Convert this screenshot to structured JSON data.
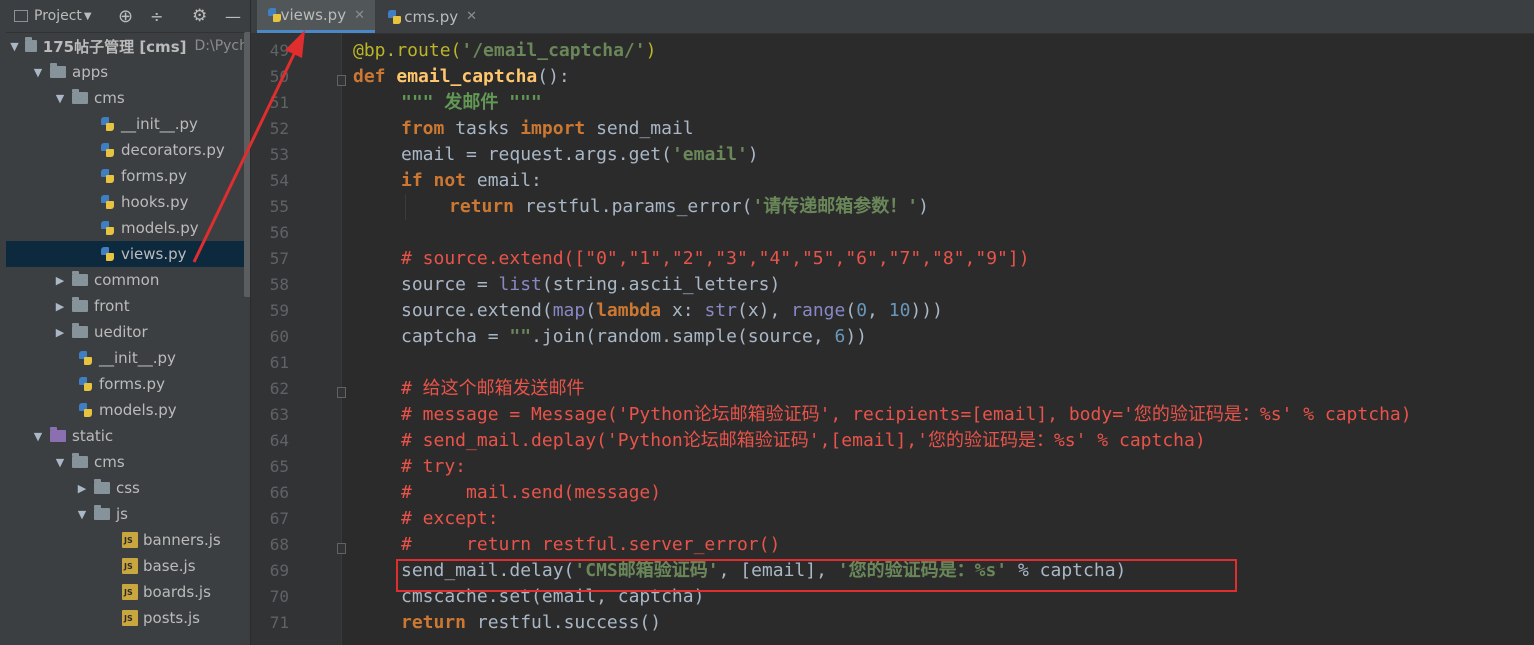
{
  "project_panel": {
    "title": "Project",
    "root_label": "175帖子管理 [cms]",
    "root_path": "D:\\Pych"
  },
  "tree": [
    {
      "label": "175帖子管理 [cms]",
      "kind": "root"
    },
    {
      "label": "apps",
      "kind": "folder"
    },
    {
      "label": "cms",
      "kind": "folder"
    },
    {
      "label": "__init__.py",
      "kind": "py"
    },
    {
      "label": "decorators.py",
      "kind": "py"
    },
    {
      "label": "forms.py",
      "kind": "py"
    },
    {
      "label": "hooks.py",
      "kind": "py"
    },
    {
      "label": "models.py",
      "kind": "py"
    },
    {
      "label": "views.py",
      "kind": "py"
    },
    {
      "label": "common",
      "kind": "folder"
    },
    {
      "label": "front",
      "kind": "folder"
    },
    {
      "label": "ueditor",
      "kind": "folder"
    },
    {
      "label": "__init__.py",
      "kind": "py"
    },
    {
      "label": "forms.py",
      "kind": "py"
    },
    {
      "label": "models.py",
      "kind": "py"
    },
    {
      "label": "static",
      "kind": "folder"
    },
    {
      "label": "cms",
      "kind": "folder"
    },
    {
      "label": "css",
      "kind": "folder"
    },
    {
      "label": "js",
      "kind": "folder"
    },
    {
      "label": "banners.js",
      "kind": "js"
    },
    {
      "label": "base.js",
      "kind": "js"
    },
    {
      "label": "boards.js",
      "kind": "js"
    },
    {
      "label": "posts.js",
      "kind": "js"
    }
  ],
  "tabs": [
    {
      "label": "views.py",
      "active": true
    },
    {
      "label": "cms.py",
      "active": false
    }
  ],
  "line_numbers": [
    "49",
    "50",
    "51",
    "52",
    "53",
    "54",
    "55",
    "56",
    "57",
    "58",
    "59",
    "60",
    "61",
    "62",
    "63",
    "64",
    "65",
    "66",
    "67",
    "68",
    "69",
    "70",
    "71"
  ],
  "code": {
    "l49_deco": "@bp.route(",
    "l49_str": "'/email_captcha/'",
    "l49_end": ")",
    "l50_kw": "def ",
    "l50_fn": "email_captcha",
    "l50_end": "():",
    "l51": "\"\"\" 发邮件 \"\"\"",
    "l52_a": "from",
    "l52_b": " tasks ",
    "l52_c": "import",
    "l52_d": " send_mail",
    "l53_a": "email = request.args.get(",
    "l53_b": "'email'",
    "l53_c": ")",
    "l54_a": "if not",
    "l54_b": " email:",
    "l55_a": "return",
    "l55_b": " restful.params_error(",
    "l55_c": "'请传递邮箱参数！'",
    "l55_d": ")",
    "l57": "# source.extend([\"0\",\"1\",\"2\",\"3\",\"4\",\"5\",\"6\",\"7\",\"8\",\"9\"])",
    "l58_a": "source = ",
    "l58_b": "list",
    "l58_c": "(string.ascii_letters)",
    "l59_a": "source.extend(",
    "l59_b": "map",
    "l59_c": "(",
    "l59_d": "lambda",
    "l59_e": " x: ",
    "l59_f": "str",
    "l59_g": "(x), ",
    "l59_h": "range",
    "l59_i": "(",
    "l59_j": "0",
    "l59_k": ", ",
    "l59_l": "10",
    "l59_m": ")))",
    "l60_a": "captcha = ",
    "l60_b": "\"\"",
    "l60_c": ".join(random.sample(source, ",
    "l60_d": "6",
    "l60_e": "))",
    "l62": "# 给这个邮箱发送邮件",
    "l63": "# message = Message('Python论坛邮箱验证码', recipients=[email], body='您的验证码是：%s' % captcha)",
    "l64": "# send_mail.deplay('Python论坛邮箱验证码',[email],'您的验证码是：%s' % captcha)",
    "l65": "# try:",
    "l66": "#     mail.send(message)",
    "l67": "# except:",
    "l68": "#     return restful.server_error()",
    "l69_a": "send_mail.delay(",
    "l69_b": "'CMS邮箱验证码'",
    "l69_c": ", [email], ",
    "l69_d": "'您的验证码是：%s'",
    "l69_e": " % captcha)",
    "l70": "cmscache.set(email, captcha)",
    "l71_a": "return",
    "l71_b": " restful.success()"
  },
  "colors": {
    "keyword": "#cc7832",
    "string": "#6a8759",
    "comment": "#e8534a",
    "highlight_border": "#e02d2d",
    "arrow": "#e02d2d"
  }
}
